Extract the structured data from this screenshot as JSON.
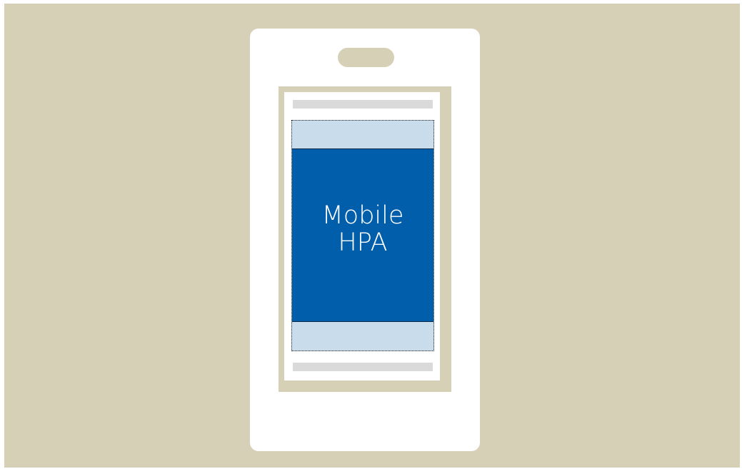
{
  "illustration": {
    "ad_unit": {
      "label_line_1": "Mobile",
      "label_line_2": "HPA"
    },
    "colors": {
      "backdrop": "#d6d0b7",
      "phone_body": "#ffffff",
      "screen_frame": "#d6d0b7",
      "content_placeholder": "#dadada",
      "expandable_area": "#c8dcec",
      "ad_unit_fill": "#005eaa",
      "ad_label_text": "#ffffff"
    }
  }
}
